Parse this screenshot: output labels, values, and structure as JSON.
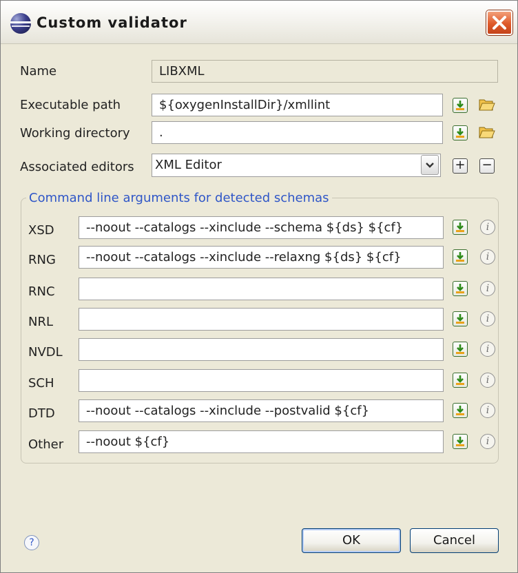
{
  "window": {
    "title": "Custom validator"
  },
  "form": {
    "name_label": "Name",
    "name_value": "LIBXML",
    "exec_label": "Executable path",
    "exec_value": "${oxygenInstallDir}/xmllint",
    "workdir_label": "Working directory",
    "workdir_value": ".",
    "editors_label": "Associated editors",
    "editors_value": "XML Editor"
  },
  "group": {
    "title": "Command line arguments for detected schemas",
    "rows": [
      {
        "label": "XSD",
        "value": "--noout --catalogs --xinclude --schema ${ds} ${cf}"
      },
      {
        "label": "RNG",
        "value": "--noout --catalogs --xinclude --relaxng ${ds} ${cf}"
      },
      {
        "label": "RNC",
        "value": ""
      },
      {
        "label": "NRL",
        "value": ""
      },
      {
        "label": "NVDL",
        "value": ""
      },
      {
        "label": "SCH",
        "value": ""
      },
      {
        "label": "DTD",
        "value": "--noout --catalogs --xinclude --postvalid ${cf}"
      },
      {
        "label": "Other",
        "value": "--noout ${cf}"
      }
    ]
  },
  "buttons": {
    "ok": "OK",
    "cancel": "Cancel",
    "add": "+",
    "remove": "−",
    "help": "?",
    "info": "i"
  },
  "icons": {
    "app": "eclipse-sphere-icon",
    "close": "close-icon",
    "insert": "insert-variable-icon",
    "browse": "folder-icon",
    "info": "info-icon",
    "help": "help-icon",
    "dropdown": "chevron-down-icon"
  },
  "colors": {
    "accent": "#2f56c7",
    "close": "#df5a2a",
    "dialog_bg": "#ece9d8"
  }
}
